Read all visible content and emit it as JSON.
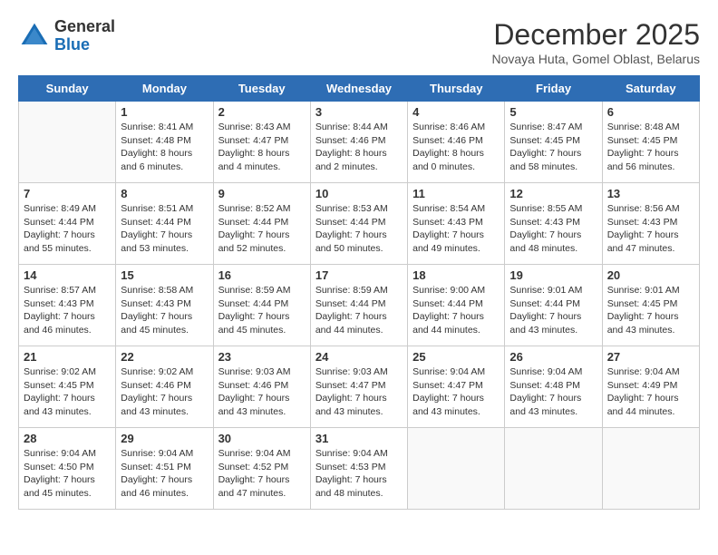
{
  "header": {
    "logo": {
      "line1": "General",
      "line2": "Blue"
    },
    "title": "December 2025",
    "subtitle": "Novaya Huta, Gomel Oblast, Belarus"
  },
  "days_of_week": [
    "Sunday",
    "Monday",
    "Tuesday",
    "Wednesday",
    "Thursday",
    "Friday",
    "Saturday"
  ],
  "weeks": [
    [
      {
        "day": "",
        "info": ""
      },
      {
        "day": "1",
        "info": "Sunrise: 8:41 AM\nSunset: 4:48 PM\nDaylight: 8 hours\nand 6 minutes."
      },
      {
        "day": "2",
        "info": "Sunrise: 8:43 AM\nSunset: 4:47 PM\nDaylight: 8 hours\nand 4 minutes."
      },
      {
        "day": "3",
        "info": "Sunrise: 8:44 AM\nSunset: 4:46 PM\nDaylight: 8 hours\nand 2 minutes."
      },
      {
        "day": "4",
        "info": "Sunrise: 8:46 AM\nSunset: 4:46 PM\nDaylight: 8 hours\nand 0 minutes."
      },
      {
        "day": "5",
        "info": "Sunrise: 8:47 AM\nSunset: 4:45 PM\nDaylight: 7 hours\nand 58 minutes."
      },
      {
        "day": "6",
        "info": "Sunrise: 8:48 AM\nSunset: 4:45 PM\nDaylight: 7 hours\nand 56 minutes."
      }
    ],
    [
      {
        "day": "7",
        "info": "Sunrise: 8:49 AM\nSunset: 4:44 PM\nDaylight: 7 hours\nand 55 minutes."
      },
      {
        "day": "8",
        "info": "Sunrise: 8:51 AM\nSunset: 4:44 PM\nDaylight: 7 hours\nand 53 minutes."
      },
      {
        "day": "9",
        "info": "Sunrise: 8:52 AM\nSunset: 4:44 PM\nDaylight: 7 hours\nand 52 minutes."
      },
      {
        "day": "10",
        "info": "Sunrise: 8:53 AM\nSunset: 4:44 PM\nDaylight: 7 hours\nand 50 minutes."
      },
      {
        "day": "11",
        "info": "Sunrise: 8:54 AM\nSunset: 4:43 PM\nDaylight: 7 hours\nand 49 minutes."
      },
      {
        "day": "12",
        "info": "Sunrise: 8:55 AM\nSunset: 4:43 PM\nDaylight: 7 hours\nand 48 minutes."
      },
      {
        "day": "13",
        "info": "Sunrise: 8:56 AM\nSunset: 4:43 PM\nDaylight: 7 hours\nand 47 minutes."
      }
    ],
    [
      {
        "day": "14",
        "info": "Sunrise: 8:57 AM\nSunset: 4:43 PM\nDaylight: 7 hours\nand 46 minutes."
      },
      {
        "day": "15",
        "info": "Sunrise: 8:58 AM\nSunset: 4:43 PM\nDaylight: 7 hours\nand 45 minutes."
      },
      {
        "day": "16",
        "info": "Sunrise: 8:59 AM\nSunset: 4:44 PM\nDaylight: 7 hours\nand 45 minutes."
      },
      {
        "day": "17",
        "info": "Sunrise: 8:59 AM\nSunset: 4:44 PM\nDaylight: 7 hours\nand 44 minutes."
      },
      {
        "day": "18",
        "info": "Sunrise: 9:00 AM\nSunset: 4:44 PM\nDaylight: 7 hours\nand 44 minutes."
      },
      {
        "day": "19",
        "info": "Sunrise: 9:01 AM\nSunset: 4:44 PM\nDaylight: 7 hours\nand 43 minutes."
      },
      {
        "day": "20",
        "info": "Sunrise: 9:01 AM\nSunset: 4:45 PM\nDaylight: 7 hours\nand 43 minutes."
      }
    ],
    [
      {
        "day": "21",
        "info": "Sunrise: 9:02 AM\nSunset: 4:45 PM\nDaylight: 7 hours\nand 43 minutes."
      },
      {
        "day": "22",
        "info": "Sunrise: 9:02 AM\nSunset: 4:46 PM\nDaylight: 7 hours\nand 43 minutes."
      },
      {
        "day": "23",
        "info": "Sunrise: 9:03 AM\nSunset: 4:46 PM\nDaylight: 7 hours\nand 43 minutes."
      },
      {
        "day": "24",
        "info": "Sunrise: 9:03 AM\nSunset: 4:47 PM\nDaylight: 7 hours\nand 43 minutes."
      },
      {
        "day": "25",
        "info": "Sunrise: 9:04 AM\nSunset: 4:47 PM\nDaylight: 7 hours\nand 43 minutes."
      },
      {
        "day": "26",
        "info": "Sunrise: 9:04 AM\nSunset: 4:48 PM\nDaylight: 7 hours\nand 43 minutes."
      },
      {
        "day": "27",
        "info": "Sunrise: 9:04 AM\nSunset: 4:49 PM\nDaylight: 7 hours\nand 44 minutes."
      }
    ],
    [
      {
        "day": "28",
        "info": "Sunrise: 9:04 AM\nSunset: 4:50 PM\nDaylight: 7 hours\nand 45 minutes."
      },
      {
        "day": "29",
        "info": "Sunrise: 9:04 AM\nSunset: 4:51 PM\nDaylight: 7 hours\nand 46 minutes."
      },
      {
        "day": "30",
        "info": "Sunrise: 9:04 AM\nSunset: 4:52 PM\nDaylight: 7 hours\nand 47 minutes."
      },
      {
        "day": "31",
        "info": "Sunrise: 9:04 AM\nSunset: 4:53 PM\nDaylight: 7 hours\nand 48 minutes."
      },
      {
        "day": "",
        "info": ""
      },
      {
        "day": "",
        "info": ""
      },
      {
        "day": "",
        "info": ""
      }
    ]
  ]
}
